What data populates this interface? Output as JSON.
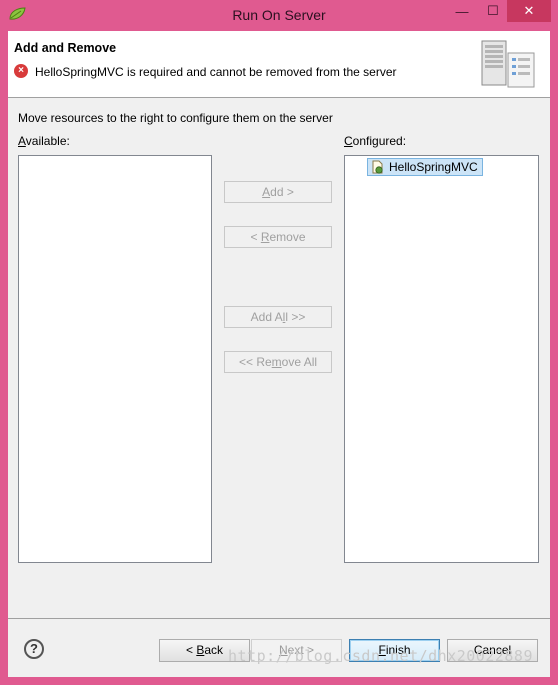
{
  "window": {
    "title": "Run On Server",
    "controls": {
      "minimize": "—",
      "maximize": "☐",
      "close": "✕"
    }
  },
  "banner": {
    "title": "Add and Remove",
    "error_message": "HelloSpringMVC is required and cannot be removed from the server",
    "error_icon": "×"
  },
  "instruction": "Move resources to the right to configure them on the server",
  "available": {
    "label": "Available:",
    "items": []
  },
  "configured": {
    "label": "Configured:",
    "items": [
      "HelloSpringMVC"
    ]
  },
  "actions": {
    "add": "Add >",
    "remove": "< Remove",
    "add_all": "Add All >>",
    "remove_all": "<< Remove All"
  },
  "footer": {
    "help": "?",
    "back": "< Back",
    "next": "Next >",
    "finish": "Finish",
    "cancel": "Cancel"
  },
  "watermark": "http://blog.csdn.net/dhx20022889",
  "colors": {
    "titlebar": "#e05a90",
    "close": "#c7375f",
    "selection": "#cce4f7"
  }
}
